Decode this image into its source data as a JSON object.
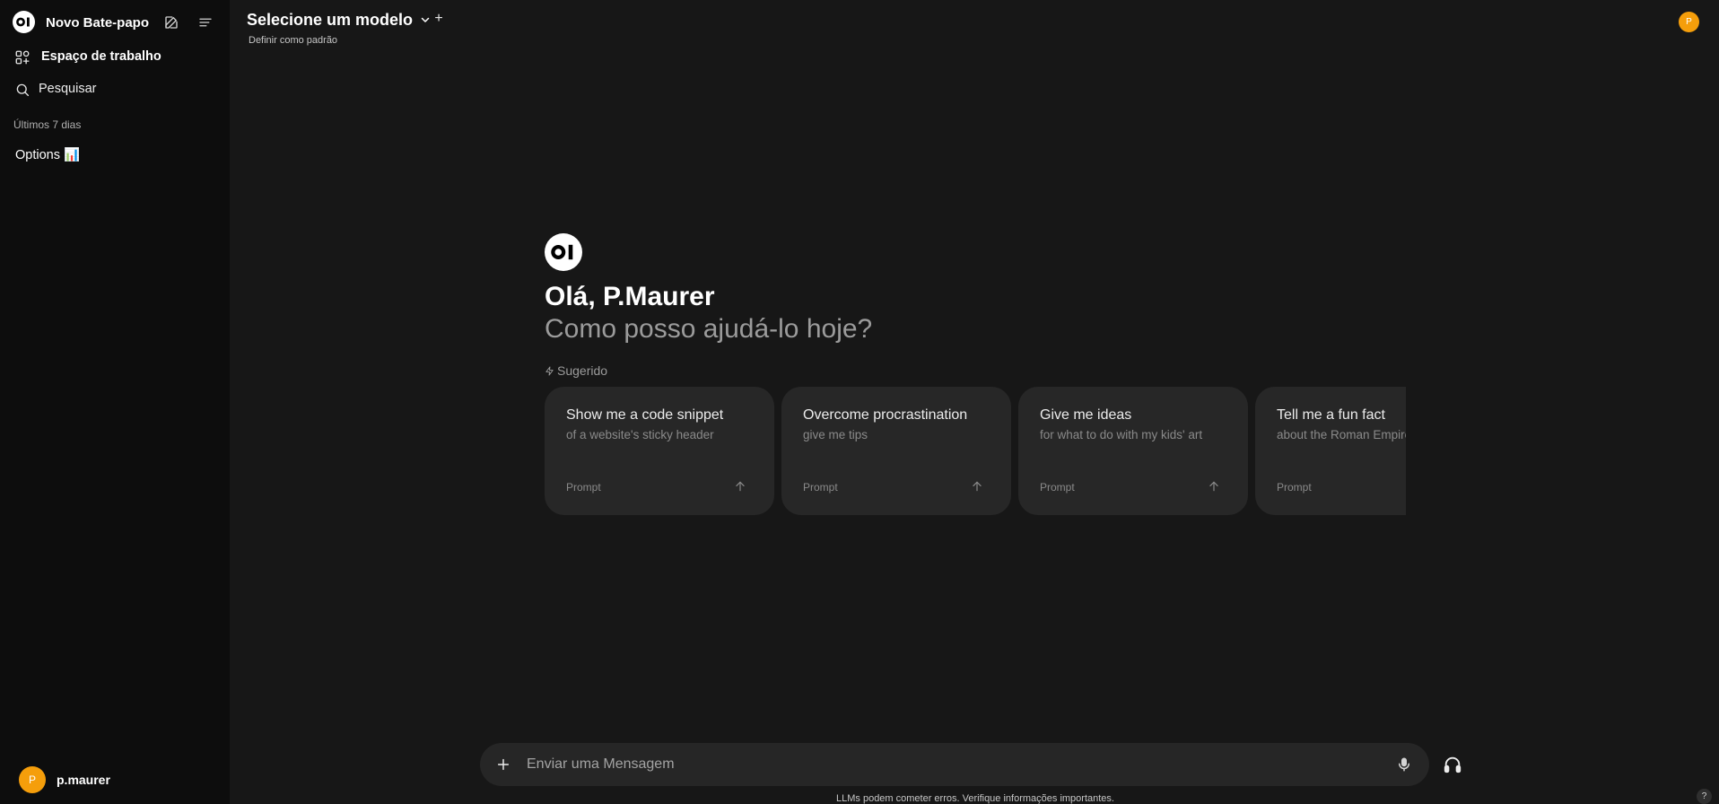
{
  "sidebar": {
    "title": "Novo Bate-papo",
    "nav": [
      {
        "label": "Espaço de trabalho",
        "icon": "workspace-icon"
      },
      {
        "label": "Pesquisar",
        "icon": "search-icon"
      }
    ],
    "section_label": "Últimos 7 dias",
    "chats": [
      {
        "label": "Options 📊"
      }
    ],
    "user": {
      "initial": "P",
      "name": "p.maurer"
    }
  },
  "header": {
    "model_select_label": "Selecione um modelo",
    "add_model": "+",
    "set_default": "Definir como padrão",
    "avatar_initial": "P"
  },
  "main": {
    "greeting": "Olá, P.Maurer",
    "subgreeting": "Como posso ajudá-lo hoje?",
    "suggested_label": "Sugerido",
    "suggestions": [
      {
        "title": "Show me a code snippet",
        "subtitle": "of a website's sticky header",
        "tag": "Prompt"
      },
      {
        "title": "Overcome procrastination",
        "subtitle": "give me tips",
        "tag": "Prompt"
      },
      {
        "title": "Give me ideas",
        "subtitle": "for what to do with my kids' art",
        "tag": "Prompt"
      },
      {
        "title": "Tell me a fun fact",
        "subtitle": "about the Roman Empire",
        "tag": "Prompt"
      }
    ]
  },
  "composer": {
    "placeholder": "Enviar uma Mensagem",
    "disclaimer": "LLMs podem cometer erros. Verifique informações importantes."
  },
  "help": {
    "label": "?"
  },
  "colors": {
    "background": "#171717",
    "sidebar": "#0d0d0d",
    "card": "#272727",
    "avatar": "#f59e0b"
  }
}
